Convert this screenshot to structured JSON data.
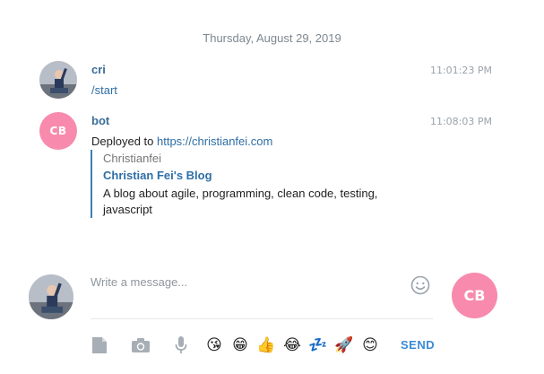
{
  "date_separator": "Thursday, August 29, 2019",
  "messages": [
    {
      "sender": "cri",
      "time": "11:01:23 PM",
      "text": "/start",
      "avatar": "user-photo"
    },
    {
      "sender": "bot",
      "time": "11:08:03 PM",
      "avatar_initials": "CB",
      "text_prefix": "Deployed to ",
      "link": "https://christianfei.com",
      "preview": {
        "site_name": "Christianfei",
        "title": "Christian Fei's Blog",
        "description": "A blog about agile, programming, clean code, testing, javascript"
      }
    }
  ],
  "compose": {
    "placeholder": "Write a message...",
    "value": "",
    "peer_initials": "CB",
    "send_label": "SEND"
  },
  "toolbar": {
    "icons": [
      "file-icon",
      "camera-icon",
      "microphone-icon"
    ],
    "emojis": [
      {
        "name": "kissing-face",
        "glyph": "😘"
      },
      {
        "name": "grinning-face",
        "glyph": "😁"
      },
      {
        "name": "thumbs-up",
        "glyph": "👍"
      },
      {
        "name": "tears-of-joy",
        "glyph": "😂"
      },
      {
        "name": "zzz",
        "glyph": "💤"
      },
      {
        "name": "rocket",
        "glyph": "🚀"
      },
      {
        "name": "smiling-face",
        "glyph": "😊"
      }
    ]
  },
  "colors": {
    "accent": "#2f6ea5",
    "bot_avatar": "#f88aae",
    "send": "#3a8ad4"
  }
}
